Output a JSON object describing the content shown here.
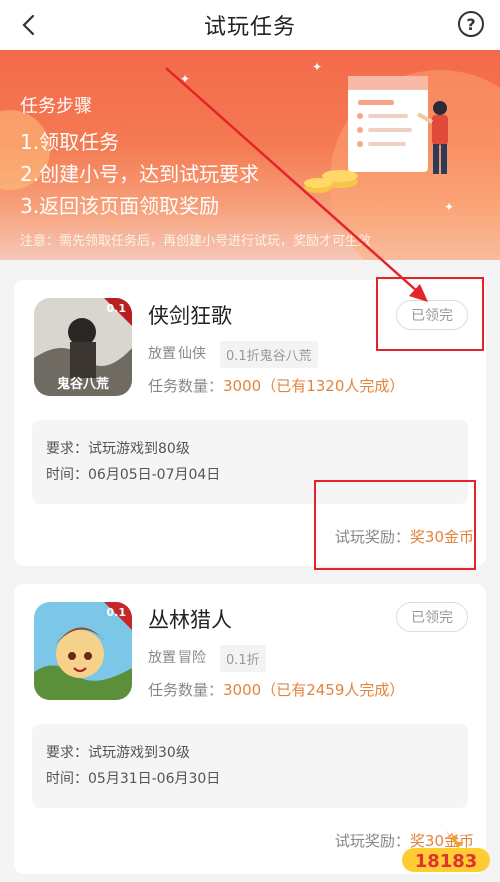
{
  "header": {
    "title": "试玩任务",
    "back_icon": "chevron-left-icon",
    "help_label": "?"
  },
  "banner": {
    "steps_title": "任务步骤",
    "steps": [
      "1.领取任务",
      "2.创建小号，达到试玩要求",
      "3.返回该页面领取奖励"
    ],
    "note": "注意：需先领取任务后，再创建小号进行试玩，奖励才可生效"
  },
  "tasks": [
    {
      "name": "侠剑狂歌",
      "tags": [
        "放置",
        "仙侠"
      ],
      "discount": "0.1折鬼谷八荒",
      "icon_badge": "0.1",
      "icon_caption": "鬼谷八荒",
      "count_label": "任务数量：",
      "count_value": "3000（已有1320人完成）",
      "status": "已领完",
      "req_label": "要求：试玩游戏到80级",
      "time_label": "时间：06月05日-07月04日",
      "reward_label": "试玩奖励：",
      "reward_value": "奖30金币"
    },
    {
      "name": "丛林猎人",
      "tags": [
        "放置",
        "冒险"
      ],
      "discount": "0.1折",
      "icon_badge": "0.1",
      "count_label": "任务数量：",
      "count_value": "3000（已有2459人完成）",
      "status": "已领完",
      "req_label": "要求：试玩游戏到30级",
      "time_label": "时间：05月31日-06月30日",
      "reward_label": "试玩奖励：",
      "reward_value": "奖30金币"
    }
  ],
  "watermark": "18183",
  "colors": {
    "accent_orange": "#e4843d",
    "banner_red": "#f36a4a",
    "annotation_red": "#e5232b"
  }
}
